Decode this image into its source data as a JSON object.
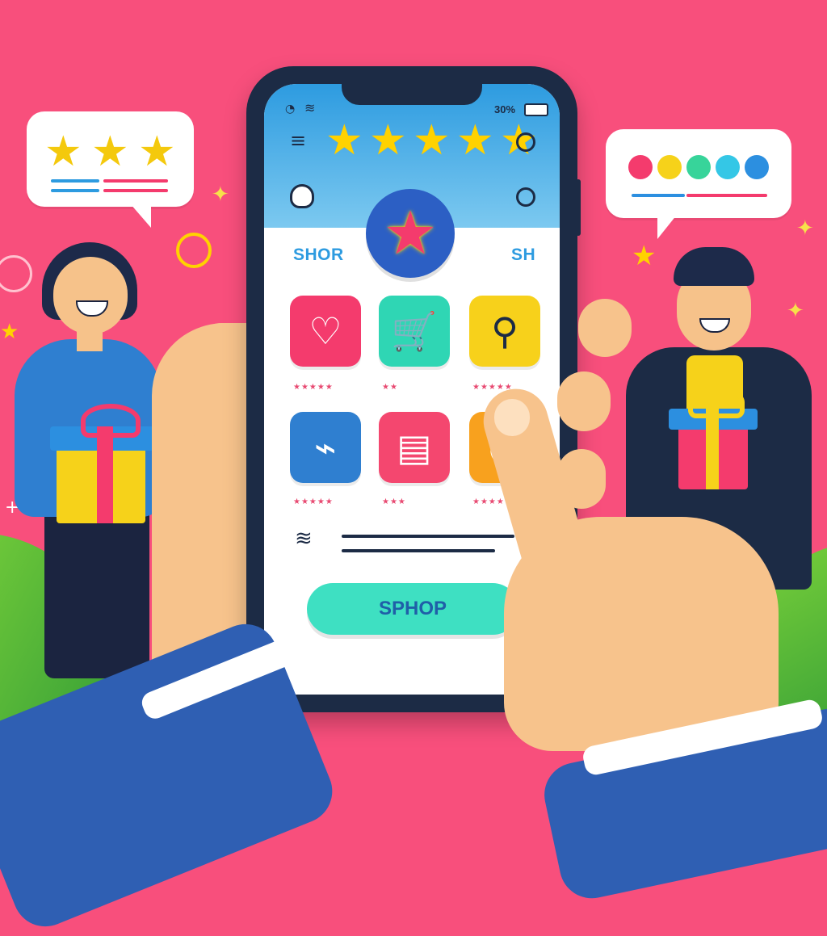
{
  "rating_bubble": {
    "stars": [
      "★",
      "★",
      "★"
    ]
  },
  "color_bubble": {
    "dots": [
      "#f43b6d",
      "#f6d21a",
      "#37d49a",
      "#34c7e6",
      "#2c8fe0"
    ]
  },
  "status_bar": {
    "battery": "30%"
  },
  "header": {
    "stars": [
      "★",
      "★",
      "★",
      "★",
      "★"
    ]
  },
  "badge": {
    "icon": "star-icon"
  },
  "sections": {
    "left": "SHOR",
    "right": "SH"
  },
  "tiles": [
    {
      "icon": "heart-icon",
      "glyph": "♡",
      "color": "#f43b6d",
      "rating": "★★★★★"
    },
    {
      "icon": "cart-icon",
      "glyph": "🛒",
      "color": "#2fd6b4",
      "rating": "★★"
    },
    {
      "icon": "map-pin-icon",
      "glyph": "⚲",
      "color": "#f7d11b",
      "rating": "★★★★★"
    },
    {
      "icon": "tag-icon",
      "glyph": "⌁",
      "color": "#2f7fd0",
      "rating": "★★★★★"
    },
    {
      "icon": "basket-icon",
      "glyph": "▤",
      "color": "#f4476f",
      "rating": "★★★"
    },
    {
      "icon": "bag-icon",
      "glyph": "●",
      "color": "#f8a11e",
      "rating": "★★★★★"
    }
  ],
  "shop_button": {
    "label": "SPHOP"
  },
  "colors": {
    "background": "#f84f7c",
    "phone": "#1c2b45",
    "accent": "#2d9be0",
    "button": "#3ee0c2"
  }
}
